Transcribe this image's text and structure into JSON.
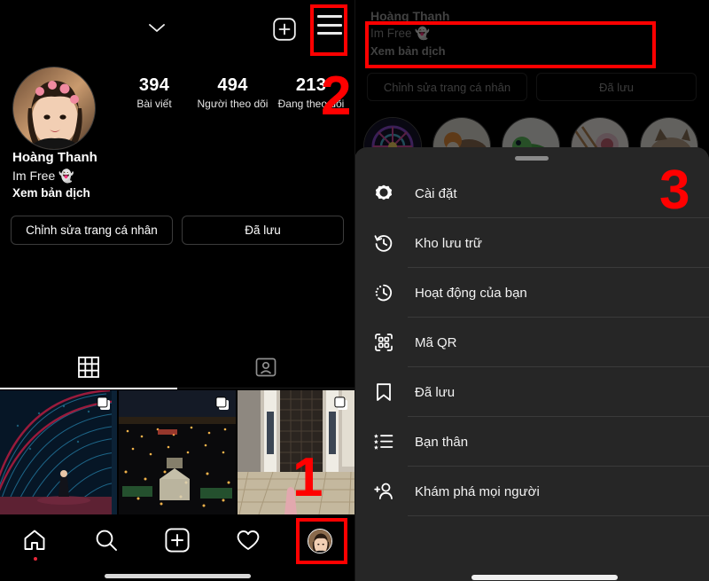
{
  "app": "Instagram profile (Vietnamese)",
  "left_panel": {
    "topbar": {
      "chevron_icon": "chevron-down-icon",
      "add_icon": "plus-square-icon",
      "menu_icon": "hamburger-menu-icon"
    },
    "profile": {
      "avatar": "user-avatar",
      "name": "Hoàng Thanh",
      "bio": "Im Free 👻",
      "translate_link": "Xem bản dịch"
    },
    "stats": [
      {
        "num": "394",
        "label": "Bài viết"
      },
      {
        "num": "494",
        "label": "Người theo dõi"
      },
      {
        "num": "213",
        "label": "Đang theo dõi"
      }
    ],
    "actions": [
      {
        "label": "Chỉnh sửa trang cá nhân"
      },
      {
        "label": "Đã lưu"
      }
    ],
    "tabs": [
      {
        "icon": "grid-icon",
        "active": true
      },
      {
        "icon": "tagged-person-icon",
        "active": false
      }
    ],
    "posts": [
      {
        "alt": "light tunnel at night",
        "multi": true
      },
      {
        "alt": "city aerial night view",
        "multi": true
      },
      {
        "alt": "building entrance doorway",
        "multi": true
      }
    ],
    "bottom_nav": [
      {
        "icon": "home-icon",
        "badge": true
      },
      {
        "icon": "search-icon",
        "badge": false
      },
      {
        "icon": "plus-square-icon",
        "badge": false
      },
      {
        "icon": "heart-icon",
        "badge": false
      },
      {
        "icon": "profile-avatar-icon",
        "badge": false
      }
    ]
  },
  "right_panel": {
    "profile": {
      "name": "Hoàng Thanh",
      "bio": "Im Free 👻",
      "translate_link": "Xem bản dịch"
    },
    "actions": [
      {
        "label": "Chỉnh sửa trang cá nhân"
      },
      {
        "label": "Đã lưu"
      }
    ],
    "highlights": [
      {
        "alt": "ferris wheel"
      },
      {
        "alt": "cartoon character"
      },
      {
        "alt": "green frog"
      },
      {
        "alt": "pink sketch"
      },
      {
        "alt": "cat photo"
      }
    ],
    "sheet": {
      "grabber": "drag-handle",
      "menu_items": [
        {
          "icon": "settings-gear-icon",
          "label": "Cài đặt"
        },
        {
          "icon": "archive-clock-icon",
          "label": "Kho lưu trữ"
        },
        {
          "icon": "activity-clock-icon",
          "label": "Hoạt động của bạn"
        },
        {
          "icon": "qr-code-icon",
          "label": "Mã QR"
        },
        {
          "icon": "bookmark-icon",
          "label": "Đã lưu"
        },
        {
          "icon": "close-friends-list-icon",
          "label": "Bạn thân"
        },
        {
          "icon": "discover-people-icon",
          "label": "Khám phá mọi người"
        }
      ]
    }
  },
  "annotations": {
    "color": "#ff0000",
    "steps": [
      {
        "num": "1",
        "target": "bottom-nav-profile-avatar"
      },
      {
        "num": "2",
        "target": "hamburger-menu-icon"
      },
      {
        "num": "3",
        "target": "settings-menu-item"
      }
    ]
  }
}
